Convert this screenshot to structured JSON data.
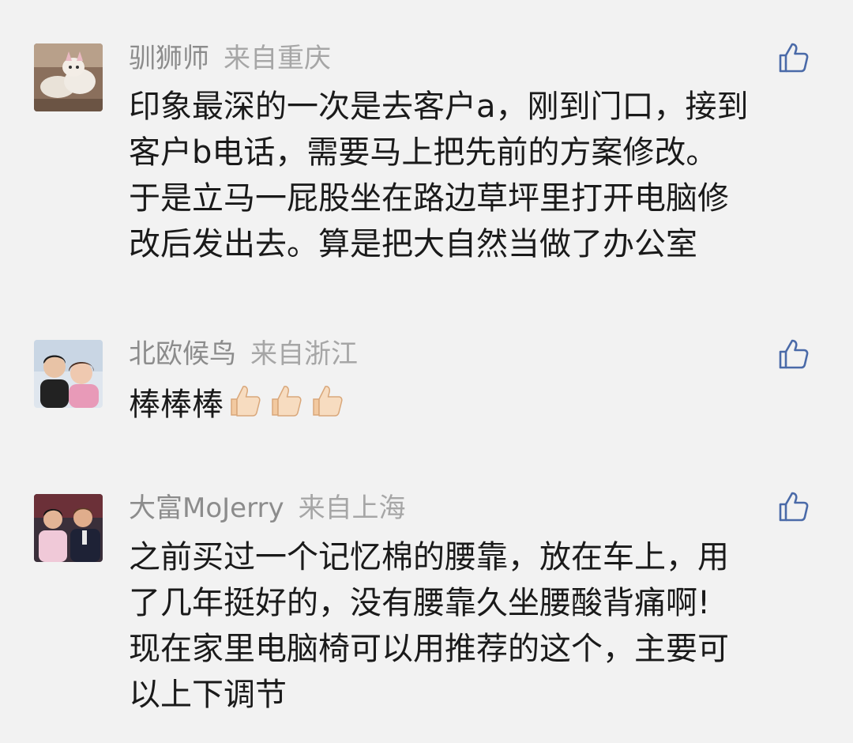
{
  "comments": [
    {
      "username": "驯狮师",
      "location": "来自重庆",
      "avatar_icon": "cat-photo-avatar",
      "lines": [
        "印象最深的一次是去客户a，刚到门口，接到",
        "客户b电话，需要马上把先前的方案修改。",
        "于是立马一屁股坐在路边草坪里打开电脑修",
        "改后发出去。算是把大自然当做了办公室"
      ]
    },
    {
      "username": "北欧候鸟",
      "location": "来自浙江",
      "avatar_icon": "two-people-photo-avatar",
      "text": "棒棒棒",
      "emoji": [
        "thumbs-up-emoji",
        "thumbs-up-emoji",
        "thumbs-up-emoji"
      ]
    },
    {
      "username": "大富MoJerry",
      "location": "来自上海",
      "avatar_icon": "two-men-photo-avatar",
      "lines": [
        "之前买过一个记忆棉的腰靠，放在车上，用",
        "了几年挺好的，没有腰靠久坐腰酸背痛啊!",
        "现在家里电脑椅可以用推荐的这个，主要可",
        "以上下调节"
      ]
    }
  ],
  "icons": {
    "like": "thumbs-up-outline-icon"
  },
  "colors": {
    "background": "#f2f2f2",
    "username": "#8c8c8c",
    "text": "#1a1a1a",
    "like_icon": "#4a6aa8"
  }
}
